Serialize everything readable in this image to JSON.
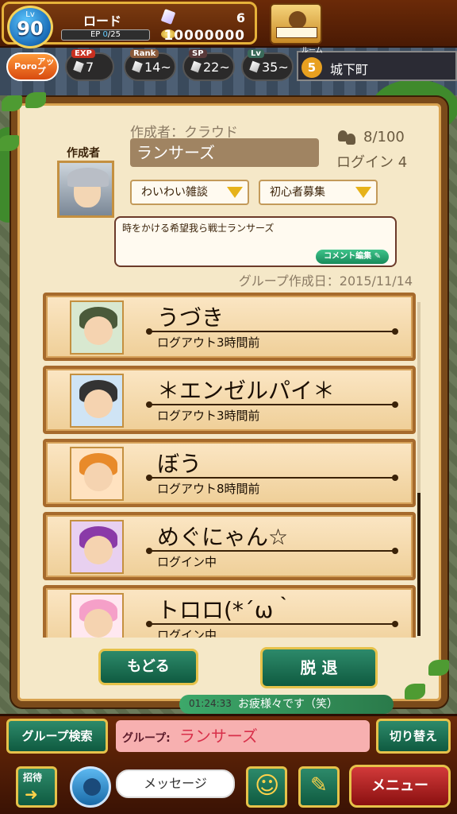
{
  "player": {
    "lv_label": "Lv",
    "level": "90",
    "name": "ロード",
    "ep_label": "EP",
    "ep_current": "0",
    "ep_max": "/25",
    "gems": "6",
    "coins": "10000000"
  },
  "buffs": [
    {
      "tag": "Poro",
      "label": "アップ"
    },
    {
      "tag": "EXP",
      "value": "7"
    },
    {
      "tag": "Rank",
      "value": "14~"
    },
    {
      "tag": "SP",
      "value": "22~"
    },
    {
      "tag": "Lv",
      "value": "35~"
    }
  ],
  "room": {
    "label": "ルーム",
    "number": "5",
    "name": "城下町"
  },
  "group": {
    "creator_label": "作成者",
    "creator": "作成者：クラウド",
    "name": "ランサーズ",
    "member_count": "8/100",
    "login_count": "ログイン 4",
    "category1": "わいわい雑談",
    "category2": "初心者募集",
    "comment": "時をかける希望我ら戦士ランサーズ",
    "comment_edit_label": "コメント編集",
    "created_date": "グループ作成日：2015/11/14"
  },
  "members": [
    {
      "name": "うづき",
      "status": "ログアウト3時間前",
      "hair": "#4a5a3a",
      "bg": "#d8e8d0"
    },
    {
      "name": "＊エンゼルパイ＊",
      "status": "ログアウト3時間前",
      "hair": "#333333",
      "bg": "#cfe4f5"
    },
    {
      "name": "ぼう",
      "status": "ログアウト8時間前",
      "hair": "#e88a2a",
      "bg": "#ffe2c0"
    },
    {
      "name": "めぐにゃん☆",
      "status": "ログイン中",
      "hair": "#8a3aa8",
      "bg": "#e8d0f0"
    },
    {
      "name": "トロロ(*´ω｀",
      "status": "ログイン中",
      "hair": "#f5a0c8",
      "bg": "#ffe8f0"
    }
  ],
  "buttons": {
    "back": "もどる",
    "leave": "脱 退"
  },
  "chat": {
    "time": "01:24:33",
    "text": "お疲様々です（笑）"
  },
  "bottom": {
    "group_search": "グループ検索",
    "group_label": "グループ:",
    "group_value": "ランサーズ",
    "switch": "切り替え",
    "invite": "招待",
    "message_placeholder": "メッセージ",
    "menu": "メニュー"
  }
}
